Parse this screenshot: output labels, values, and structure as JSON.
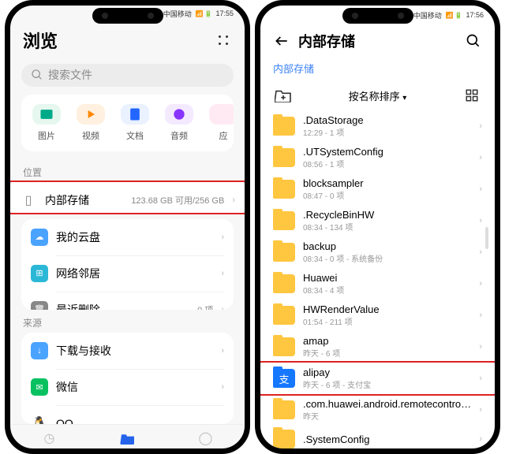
{
  "left": {
    "status": {
      "carrier": "中国移动",
      "indicators": "📶 📶 ⚡ 🔋",
      "time": "17:55"
    },
    "title": "浏览",
    "search_placeholder": "搜索文件",
    "categories": [
      {
        "label": "图片",
        "color": "#e6f7ef",
        "glyph": "◆"
      },
      {
        "label": "视频",
        "color": "#fff0e0",
        "glyph": "▶"
      },
      {
        "label": "文档",
        "color": "#eaf1ff",
        "glyph": "≣"
      },
      {
        "label": "音频",
        "color": "#f3eaff",
        "glyph": "●"
      },
      {
        "label": "应",
        "color": "#ffeaf3",
        "glyph": "◼"
      }
    ],
    "section_location": "位置",
    "storage": {
      "label": "内部存储",
      "detail": "123.68 GB 可用/256 GB"
    },
    "cloud_label": "我的云盘",
    "network_label": "网络邻居",
    "recent_label": "最近删除",
    "recent_count": "0 项",
    "section_sources": "来源",
    "download_label": "下载与接收",
    "wechat_label": "微信",
    "qq_label": "QQ"
  },
  "right": {
    "status": {
      "carrier": "中国移动",
      "indicators": "📶 📶 ⚡ 🔋",
      "time": "17:56"
    },
    "title": "内部存储",
    "breadcrumb": "内部存储",
    "sort_label": "按名称排序",
    "folders": [
      {
        "name": ".DataStorage",
        "meta": "12:29 - 1 项"
      },
      {
        "name": ".UTSystemConfig",
        "meta": "08:56 - 1 项"
      },
      {
        "name": "blocksampler",
        "meta": "08:47 - 0 项"
      },
      {
        "name": ".RecycleBinHW",
        "meta": "08:34 - 134 项"
      },
      {
        "name": "backup",
        "meta": "08:34 - 0 项 - 系统备份"
      },
      {
        "name": "Huawei",
        "meta": "08:34 - 4 项"
      },
      {
        "name": "HWRenderValue",
        "meta": "01:54 - 211 项"
      },
      {
        "name": "amap",
        "meta": "昨天 - 6 项"
      },
      {
        "name": "alipay",
        "meta": "昨天 - 6 项 - 支付宝",
        "app": true,
        "highlight": true
      },
      {
        "name": ".com.huawei.android.remotecontroller",
        "meta": "昨天"
      },
      {
        "name": ".SystemConfig",
        "meta": ""
      }
    ]
  }
}
